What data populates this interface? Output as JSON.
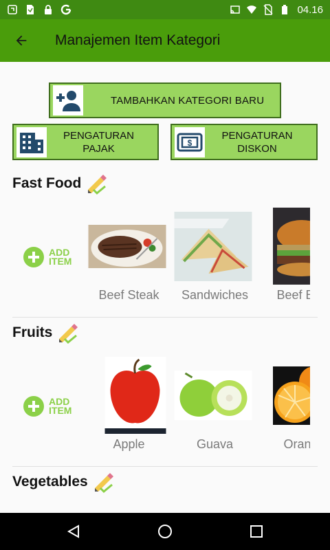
{
  "status_bar": {
    "time": "04.16",
    "icons_left": [
      "app-icon",
      "doc-icon",
      "lock-icon",
      "google-icon"
    ],
    "icons_right": [
      "cast-icon",
      "wifi-icon",
      "no-sim-icon",
      "battery-icon"
    ]
  },
  "app_bar": {
    "title": "Manajemen Item Kategori",
    "back_icon": "arrow-back-icon",
    "color": "#4a9d0b"
  },
  "actions": {
    "add_category": "TAMBAHKAN KATEGORI BARU",
    "tax_settings_line1": "PENGATURAN",
    "tax_settings_line2": "PAJAK",
    "discount_settings_line1": "PENGATURAN",
    "discount_settings_line2": "DISKON",
    "button_color": "#9ad65f"
  },
  "add_item_label_1": "ADD",
  "add_item_label_2": "ITEM",
  "categories": [
    {
      "name": "Fast Food",
      "items": [
        {
          "name": "Beef Steak",
          "image": "beef-steak"
        },
        {
          "name": "Sandwiches",
          "image": "sandwiches"
        },
        {
          "name": "Beef Bur",
          "image": "beef-burger"
        }
      ]
    },
    {
      "name": "Fruits",
      "items": [
        {
          "name": "Apple",
          "image": "apple"
        },
        {
          "name": "Guava",
          "image": "guava"
        },
        {
          "name": "Orang",
          "image": "orange"
        }
      ]
    },
    {
      "name": "Vegetables",
      "items": []
    }
  ],
  "nav": [
    "back-nav-icon",
    "home-nav-icon",
    "recents-nav-icon"
  ]
}
